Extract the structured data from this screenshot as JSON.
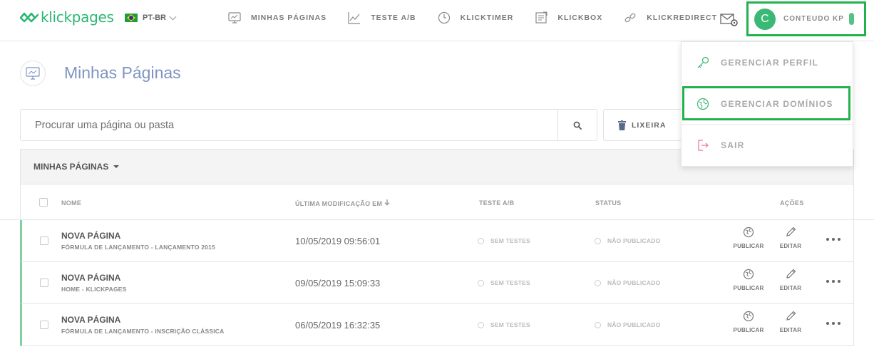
{
  "brand": {
    "logo_text": "klickpages",
    "accent": "#2bb673"
  },
  "language": {
    "label": "PT-BR"
  },
  "nav": [
    {
      "label": "MINHAS PÁGINAS",
      "icon": "monitor-icon"
    },
    {
      "label": "TESTE A/B",
      "icon": "chart-icon"
    },
    {
      "label": "KLICKTIMER",
      "icon": "clock-icon"
    },
    {
      "label": "KLICKBOX",
      "icon": "box-icon"
    },
    {
      "label": "KLICKREDIRECT",
      "icon": "link-icon"
    }
  ],
  "user": {
    "initial": "C",
    "name": "CONTEUDO KP"
  },
  "user_menu": [
    {
      "label": "GERENCIAR PERFIL",
      "icon": "key-icon"
    },
    {
      "label": "GERENCIAR DOMÍNIOS",
      "icon": "globe-icon"
    },
    {
      "label": "SAIR",
      "icon": "exit-icon"
    }
  ],
  "page": {
    "title": "Minhas Páginas"
  },
  "search": {
    "placeholder": "Procurar uma página ou pasta"
  },
  "trash": {
    "label": "LIXEIRA"
  },
  "table": {
    "folder_label": "MINHAS PÁGINAS",
    "columns": {
      "name": "NOME",
      "modified": "ÚLTIMA MODIFICAÇÃO EM",
      "ab": "TESTE A/B",
      "status": "STATUS",
      "actions": "AÇÕES"
    },
    "rows": [
      {
        "name": "NOVA PÁGINA",
        "subtitle": "FÓRMULA DE LANÇAMENTO - LANÇAMENTO 2015",
        "modified": "10/05/2019 09:56:01",
        "ab": "SEM TESTES",
        "status": "NÃO PUBLICADO",
        "publish": "PUBLICAR",
        "edit": "EDITAR"
      },
      {
        "name": "NOVA PÁGINA",
        "subtitle": "HOME - KLICKPAGES",
        "modified": "09/05/2019 15:09:33",
        "ab": "SEM TESTES",
        "status": "NÃO PUBLICADO",
        "publish": "PUBLICAR",
        "edit": "EDITAR"
      },
      {
        "name": "NOVA PÁGINA",
        "subtitle": "FÓRMULA DE LANÇAMENTO - INSCRIÇÃO CLÁSSICA",
        "modified": "06/05/2019 16:32:35",
        "ab": "SEM TESTES",
        "status": "NÃO PUBLICADO",
        "publish": "PUBLICAR",
        "edit": "EDITAR"
      }
    ]
  }
}
